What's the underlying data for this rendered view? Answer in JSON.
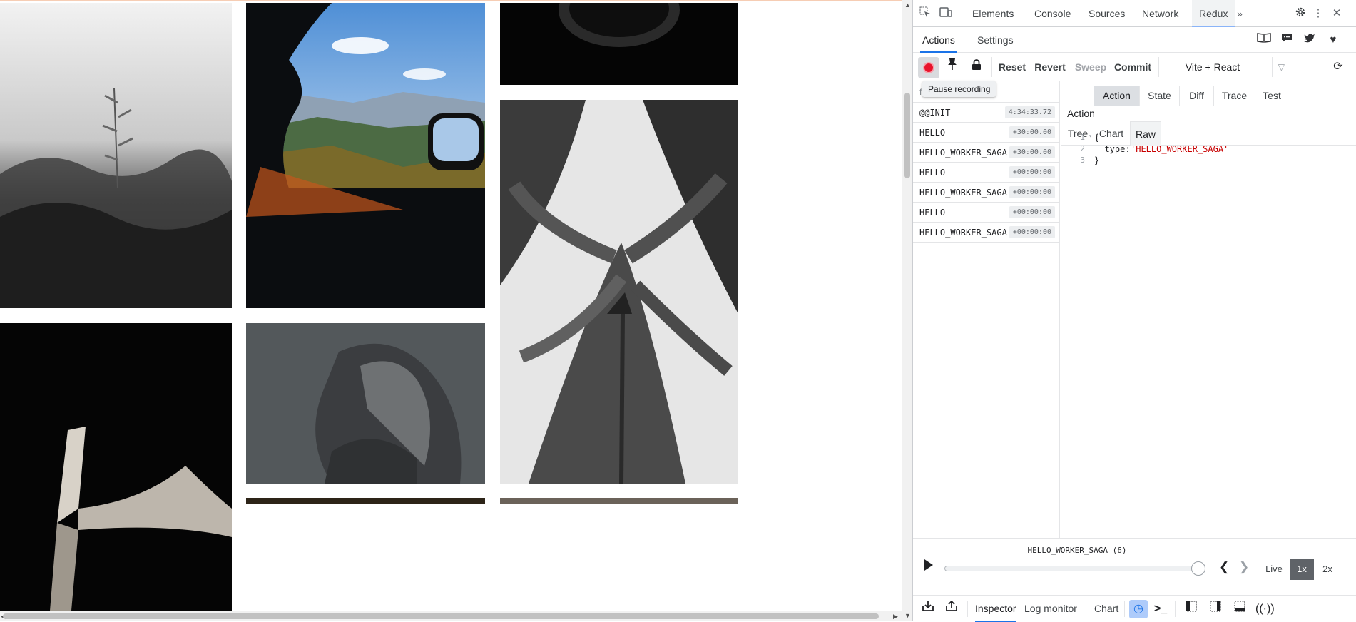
{
  "gallery": {
    "photos": [
      {
        "name": "photo-grass-bw",
        "alt": ""
      },
      {
        "name": "photo-car-window-mountains",
        "alt": ""
      },
      {
        "name": "photo-dark-dome",
        "alt": ""
      },
      {
        "name": "photo-leaves-bw",
        "alt": ""
      },
      {
        "name": "photo-ribbon-dark",
        "alt": ""
      },
      {
        "name": "photo-gray-sculpture",
        "alt": ""
      }
    ]
  },
  "devtools": {
    "main_tabs": [
      "Elements",
      "Console",
      "Sources",
      "Network",
      "Redux"
    ],
    "active_main_tab": "Redux",
    "more_icon": "chevron-double-right-icon",
    "settings_icon": "gear-icon",
    "menu_icon": "kebab-icon",
    "close_icon": "close-icon",
    "inspect_icon": "inspect-element-icon",
    "device_icon": "device-toggle-icon"
  },
  "redux": {
    "subtabs": [
      "Actions",
      "Settings"
    ],
    "active_subtab": "Actions",
    "toolbar": {
      "reset": "Reset",
      "revert": "Revert",
      "sweep": "Sweep",
      "commit": "Commit",
      "instance": "Vite + React",
      "tooltip": "Pause recording",
      "filter_placeholder": "f"
    },
    "actions": [
      {
        "name": "@@INIT",
        "time": "4:34:33.72"
      },
      {
        "name": "HELLO",
        "time": "+30:00.00"
      },
      {
        "name": "HELLO_WORKER_SAGA",
        "time": "+30:00.00"
      },
      {
        "name": "HELLO",
        "time": "+00:00:00"
      },
      {
        "name": "HELLO_WORKER_SAGA",
        "time": "+00:00:00"
      },
      {
        "name": "HELLO",
        "time": "+00:00:00"
      },
      {
        "name": "HELLO_WORKER_SAGA",
        "time": "+00:00:00"
      }
    ],
    "panel_tabs": [
      "Action",
      "State",
      "Diff",
      "Trace",
      "Test"
    ],
    "active_panel_tab": "Action",
    "panel_title": "Action",
    "view_tabs": [
      "Tree",
      "Chart",
      "Raw"
    ],
    "active_view_tab": "Raw",
    "code": {
      "lines": [
        "1",
        "2",
        "3"
      ],
      "open": "{",
      "key": "  type: ",
      "value": "'HELLO_WORKER_SAGA'",
      "close": "}"
    },
    "slider": {
      "current_label": "HELLO_WORKER_SAGA (6)",
      "position_fraction": 1.0,
      "live": "Live",
      "speed_1x": "1x",
      "speed_2x": "2x",
      "active_speed": "1x"
    },
    "bottom_tabs": [
      "Inspector",
      "Log monitor",
      "Chart"
    ],
    "active_bottom_tab": "Inspector"
  },
  "colors": {
    "record_red": "#e8132b",
    "accent_blue": "#1a73e8",
    "string_red": "#c80000"
  }
}
